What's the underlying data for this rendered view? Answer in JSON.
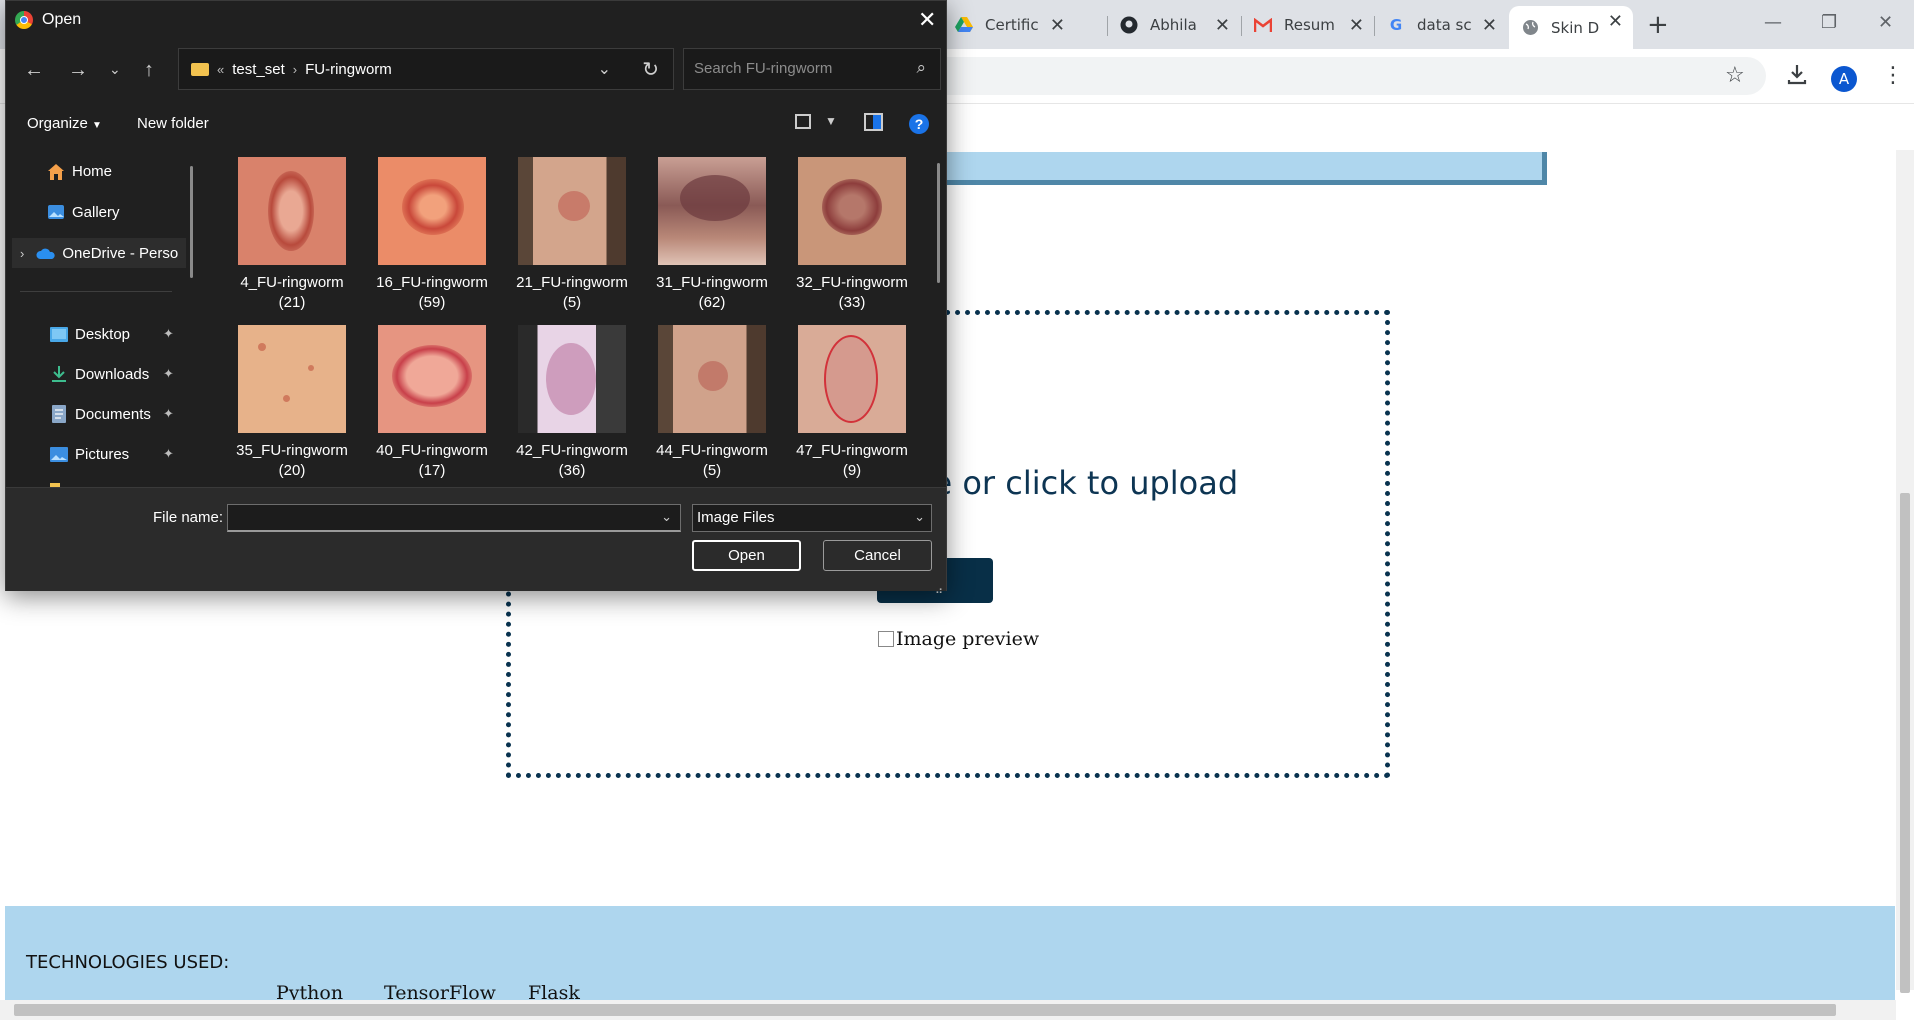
{
  "browser": {
    "tabs": [
      {
        "label": "Certific",
        "icon": "google-drive-icon"
      },
      {
        "label": "Abhila",
        "icon": "github-icon"
      },
      {
        "label": "Resum",
        "icon": "gmail-icon"
      },
      {
        "label": "data sc",
        "icon": "google-icon"
      },
      {
        "label": "Skin D",
        "icon": "globe-icon",
        "active": true
      }
    ],
    "avatar_letter": "A"
  },
  "page": {
    "dropzone_text": "re or click to upload",
    "predict_label": "CT",
    "image_preview_alt": "Image preview",
    "technologies_title": "TECHNOLOGIES USED:",
    "technologies": [
      "Python",
      "TensorFlow",
      "Flask"
    ]
  },
  "dialog": {
    "title": "Open",
    "breadcrumb": [
      "test_set",
      "FU-ringworm"
    ],
    "breadcrumb_prefix": "«",
    "search_placeholder": "Search FU-ringworm",
    "organize_label": "Organize",
    "new_folder_label": "New folder",
    "nav_items": [
      {
        "label": "Home",
        "icon": "home-icon"
      },
      {
        "label": "Gallery",
        "icon": "gallery-icon"
      },
      {
        "label": "OneDrive - Perso",
        "icon": "onedrive-icon"
      },
      {
        "label": "Desktop",
        "icon": "desktop-icon",
        "pinned": true
      },
      {
        "label": "Downloads",
        "icon": "downloads-icon",
        "pinned": true
      },
      {
        "label": "Documents",
        "icon": "documents-icon",
        "pinned": true
      },
      {
        "label": "Pictures",
        "icon": "pictures-icon",
        "pinned": true
      }
    ],
    "files": [
      {
        "name": "4_FU-ringworm",
        "count": "(21)"
      },
      {
        "name": "16_FU-ringworm",
        "count": "(59)"
      },
      {
        "name": "21_FU-ringworm",
        "count": "(5)"
      },
      {
        "name": "31_FU-ringworm",
        "count": "(62)"
      },
      {
        "name": "32_FU-ringworm",
        "count": "(33)"
      },
      {
        "name": "35_FU-ringworm",
        "count": "(20)"
      },
      {
        "name": "40_FU-ringworm",
        "count": "(17)"
      },
      {
        "name": "42_FU-ringworm",
        "count": "(36)"
      },
      {
        "name": "44_FU-ringworm",
        "count": "(5)"
      },
      {
        "name": "47_FU-ringworm",
        "count": "(9)"
      }
    ],
    "file_name_label": "File name:",
    "file_name_value": "",
    "file_type_value": "Image Files",
    "open_label": "Open",
    "cancel_label": "Cancel"
  },
  "colors": {
    "dialog_bg": "#202020",
    "accent_blue": "#1a73e8",
    "page_banner": "#aed6ee",
    "dropzone_border": "#08324f",
    "predict_button": "#082f47"
  }
}
